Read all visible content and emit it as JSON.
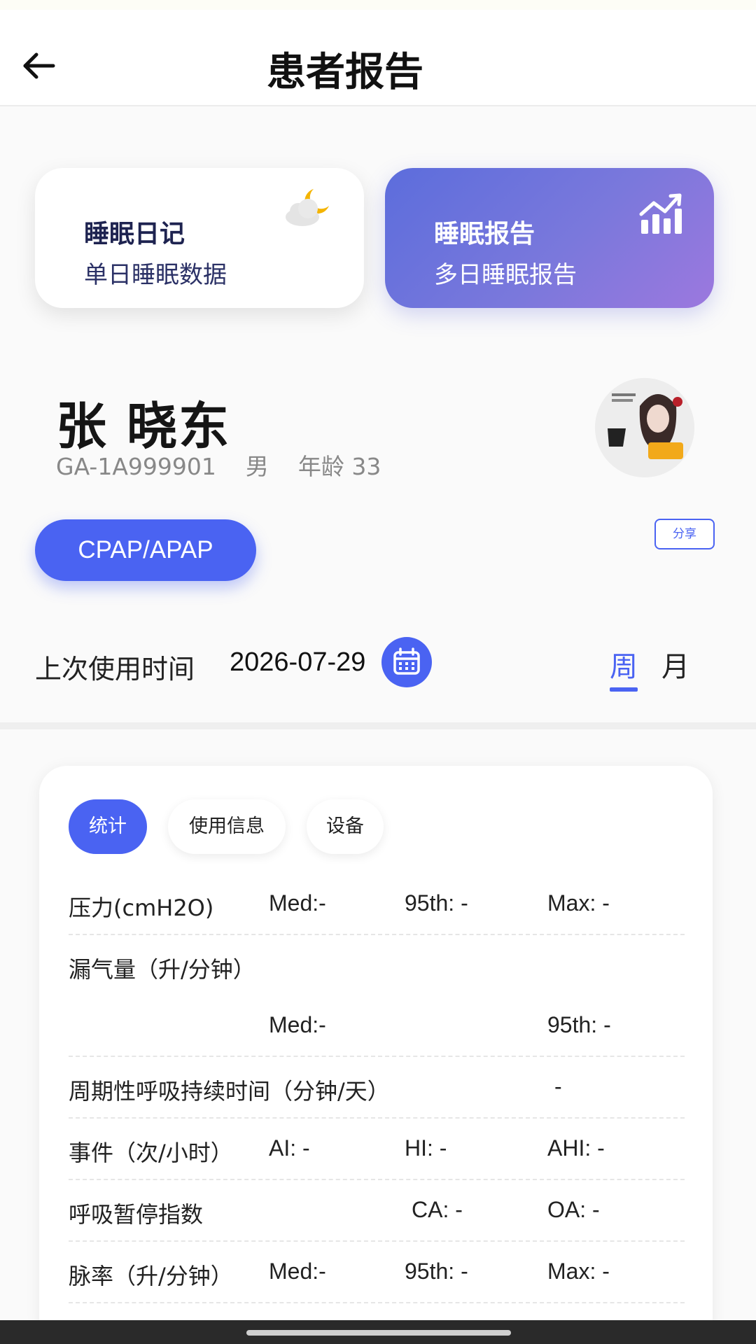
{
  "header": {
    "title": "患者报告",
    "back_icon": "arrow-left-icon"
  },
  "cards": {
    "diary": {
      "title": "睡眠日记",
      "subtitle": "单日睡眠数据",
      "icon": "cloud-moon-icon",
      "moon_color": "#f4b400"
    },
    "report": {
      "title": "睡眠报告",
      "subtitle": "多日睡眠报告",
      "icon": "bar-chart-trend-icon"
    }
  },
  "patient": {
    "name": "张 晓东",
    "id": "GA-1A999901",
    "gender": "男",
    "age_label": "年龄 33"
  },
  "mode_button": "CPAP/APAP",
  "share_button": "分享",
  "last_use": {
    "label": "上次使用时间",
    "date": "2026-07-29",
    "icon": "calendar-icon"
  },
  "period_tabs": {
    "week": "周",
    "month": "月",
    "selected": "周"
  },
  "stats": {
    "tabs": {
      "stats": "统计",
      "usage": "使用信息",
      "device": "设备",
      "selected": "统计"
    },
    "rows": {
      "pressure": {
        "label": "压力(cmH2O)",
        "med": "Med:-",
        "p95": "95th: -",
        "max": "Max: -"
      },
      "leak": {
        "label": "漏气量（升/分钟）",
        "med": "Med:-",
        "p95": "95th: -"
      },
      "periodic": {
        "label": "周期性呼吸持续时间（分钟/天）",
        "value": "-"
      },
      "events": {
        "label": "事件（次/小时）",
        "ai": "AI: -",
        "hi": "HI: -",
        "ahi": "AHI: -"
      },
      "apnea": {
        "label": "呼吸暂停指数",
        "ca": "CA: -",
        "oa": "OA: -"
      },
      "pulse": {
        "label": "脉率（升/分钟）",
        "med": "Med:-",
        "p95": "95th: -",
        "max": "Max: -"
      }
    }
  },
  "colors": {
    "accent": "#4a63f2",
    "report_gradient_start": "#5c6ddc",
    "report_gradient_end": "#9c78de"
  }
}
